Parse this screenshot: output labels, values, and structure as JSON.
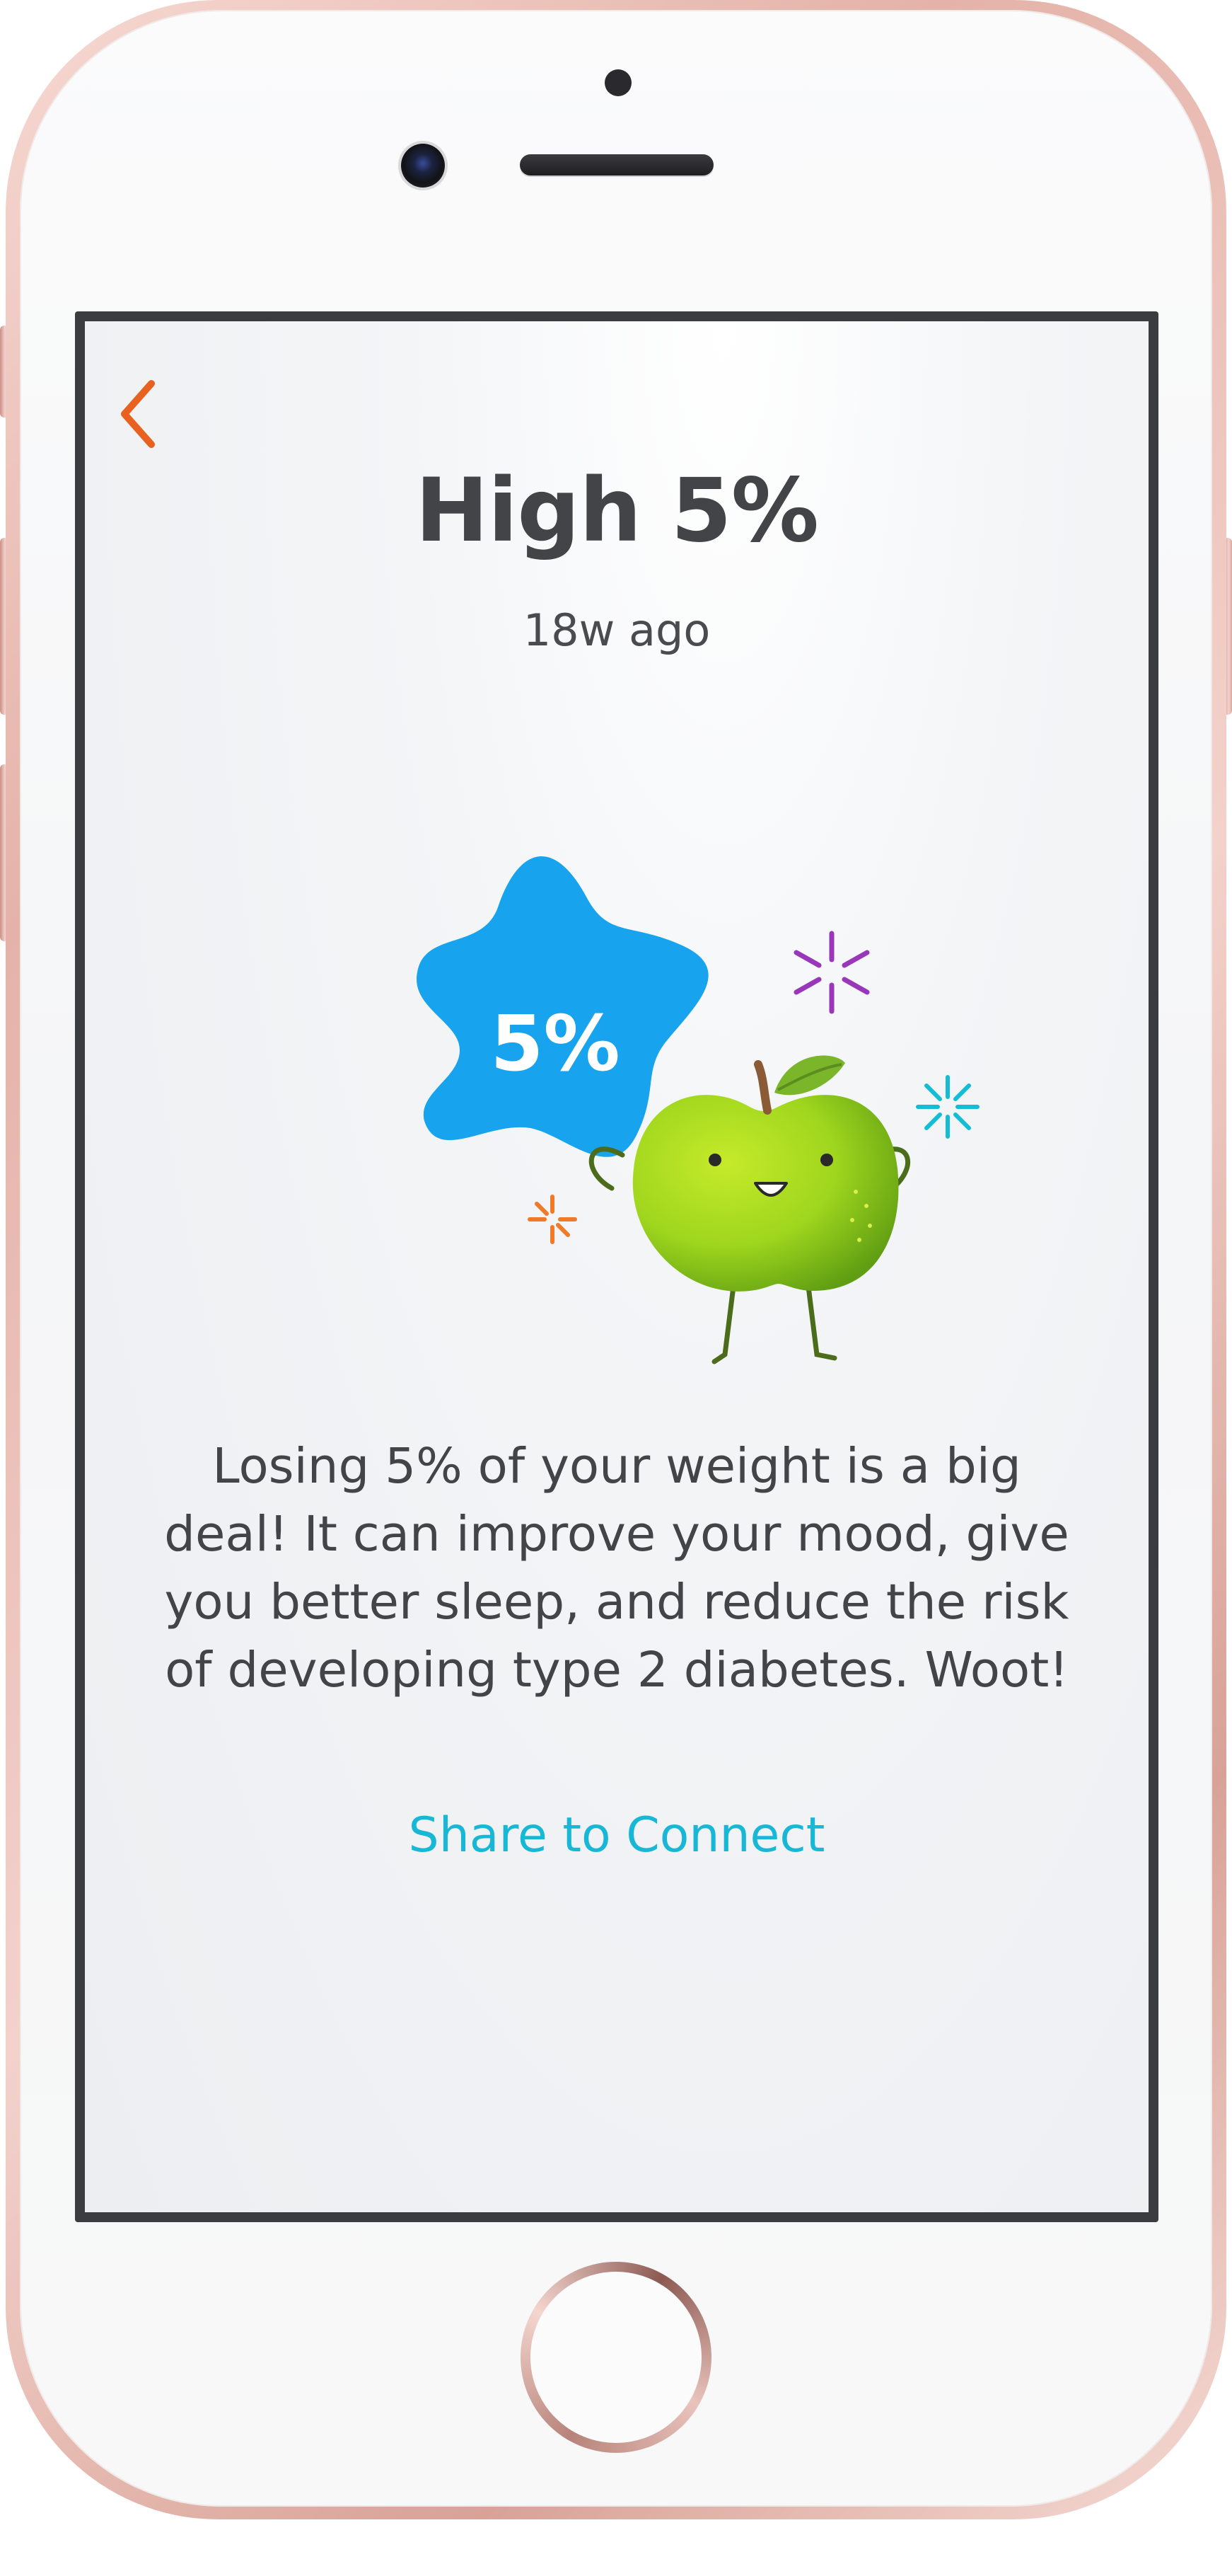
{
  "screen": {
    "title": "High 5%",
    "timestamp": "18w ago",
    "badge_text": "5%",
    "message": "Losing 5% of your weight is a big deal! It can improve your mood, give you better sleep, and reduce the risk of developing type 2 diabetes. Woot!",
    "share_label": "Share to Connect"
  },
  "icons": {
    "back": "chevron-left-icon",
    "badge": "star-badge-icon",
    "mascot": "apple-mascot-icon",
    "sparkles": "sparkle-icon"
  },
  "colors": {
    "accent_back": "#e8611f",
    "badge_blue": "#17a3ee",
    "apple_green": "#9fd61e",
    "link": "#19b7d6",
    "sparkle_purple": "#9a36b9",
    "sparkle_cyan": "#14bcd6",
    "sparkle_orange": "#f07a2a",
    "text": "#434447",
    "phone_rose": "#e4b2a8"
  }
}
